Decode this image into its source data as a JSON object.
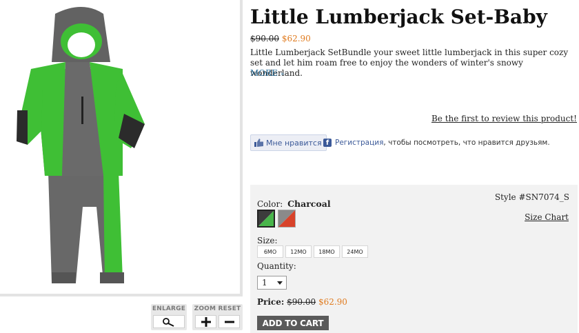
{
  "product": {
    "title": "Little Lumberjack Set-Baby",
    "old_price": "$90.00",
    "sale_price": "$62.90",
    "description": "Little Lumberjack SetBundle your sweet little lumberjack in this super cozy set and let him roam free to enjoy the wonders of winter's snowy wonderland.",
    "more_label": "MORE",
    "more_icon": "chevron-double-down-icon",
    "review_link": "Be the first to review this product!"
  },
  "image_controls": {
    "enlarge_label": "ENLARGE",
    "enlarge_icon": "magnifier-icon",
    "zoom_label": "ZOOM",
    "reset_label": "RESET",
    "zoom_in_icon": "plus-icon",
    "zoom_out_icon": "minus-icon"
  },
  "social": {
    "like_label": "Мне нравится",
    "register_label": "Регистрация",
    "register_suffix": ", чтобы посмотреть, что нравится друзьям."
  },
  "options": {
    "style_number": "Style #SN7074_S",
    "size_chart_label": "Size Chart",
    "color_label": "Color:",
    "color_value": "Charcoal",
    "size_label": "Size:",
    "sizes": [
      "6MO",
      "12MO",
      "18MO",
      "24MO"
    ],
    "quantity_label": "Quantity:",
    "quantity_value": "1",
    "price_label": "Price:",
    "old_price": "$90.00",
    "sale_price": "$62.90",
    "add_to_cart_label": "ADD TO CART"
  },
  "colors": {
    "sale_price": "#e07b1f",
    "link_blue": "#2a6f9a",
    "facebook_blue": "#3b5998",
    "add_to_cart_bg": "#5a5a5a",
    "swatch_charcoal": [
      "#3c3c3c",
      "#48b54a"
    ],
    "swatch_other": [
      "#8a8a8a",
      "#d8432a"
    ]
  }
}
